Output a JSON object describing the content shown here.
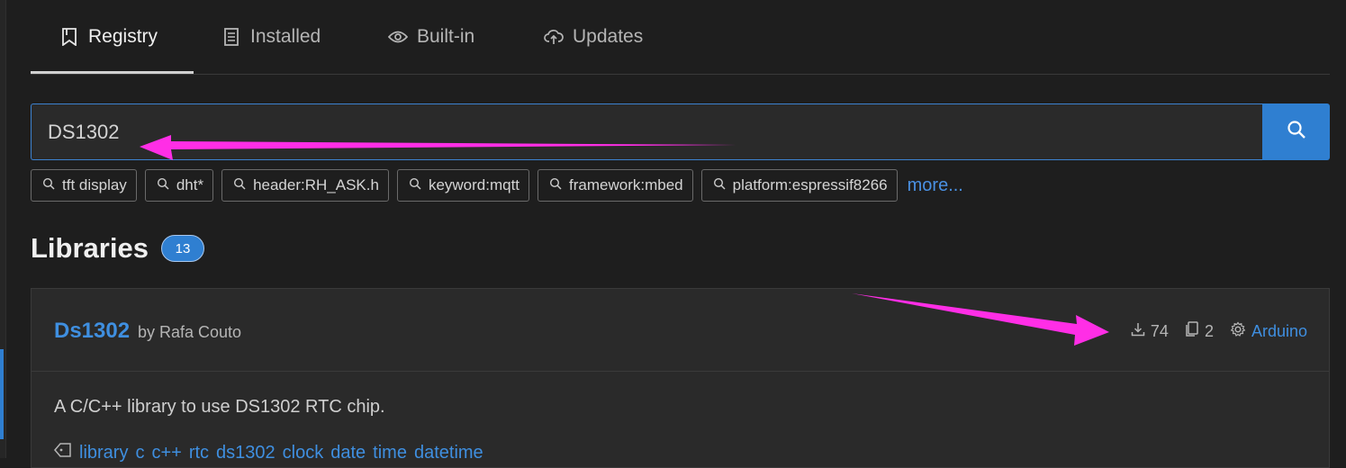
{
  "tabs": [
    {
      "label": "Registry",
      "icon": "bookmark-icon",
      "active": true
    },
    {
      "label": "Installed",
      "icon": "installed-icon",
      "active": false
    },
    {
      "label": "Built-in",
      "icon": "eye-icon",
      "active": false
    },
    {
      "label": "Updates",
      "icon": "cloud-upload-icon",
      "active": false
    }
  ],
  "search": {
    "value": "DS1302",
    "button_icon": "search-icon"
  },
  "suggestions": {
    "chips": [
      "tft display",
      "dht*",
      "header:RH_ASK.h",
      "keyword:mqtt",
      "framework:mbed",
      "platform:espressif8266"
    ],
    "more_label": "more..."
  },
  "libraries": {
    "title": "Libraries",
    "count": "13"
  },
  "result": {
    "name": "Ds1302",
    "by": "by Rafa Couto",
    "downloads": "74",
    "examples": "2",
    "platform": "Arduino",
    "description": "A C/C++ library to use DS1302 RTC chip.",
    "tags": [
      "library",
      "c",
      "c++",
      "rtc",
      "ds1302",
      "clock",
      "date",
      "time",
      "datetime"
    ]
  },
  "colors": {
    "accent": "#2f7fd1",
    "link": "#3f8fe0",
    "annotation_arrow": "#ff2ee6",
    "background": "#1e1e1e"
  }
}
